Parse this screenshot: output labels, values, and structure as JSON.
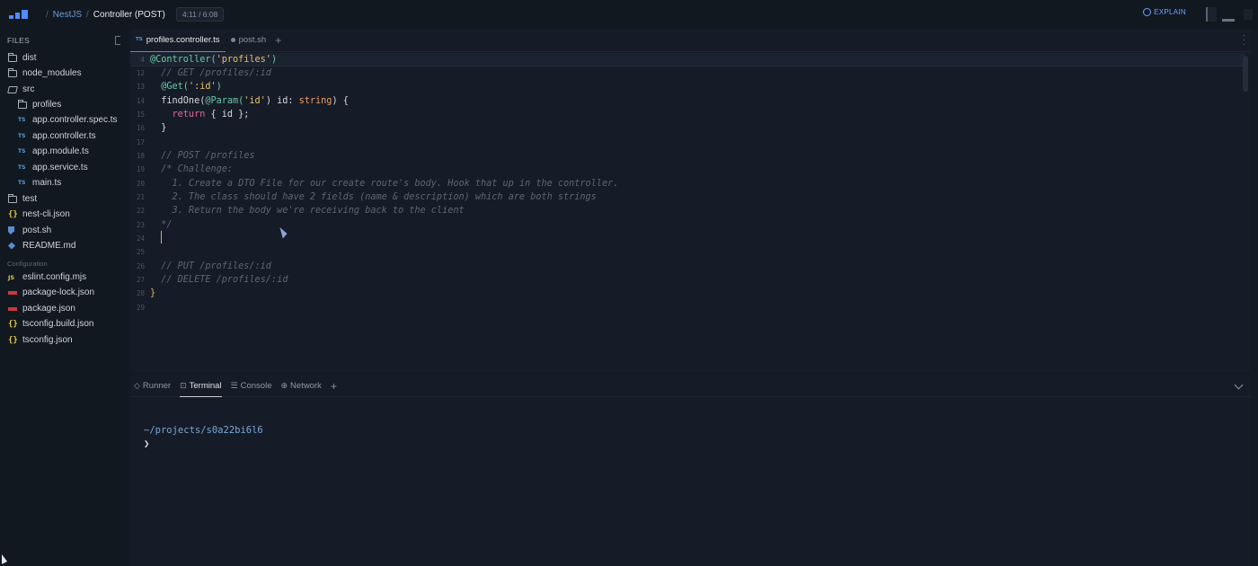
{
  "topbar": {
    "breadcrumb_parent": "NestJS",
    "breadcrumb_current": "Controller (POST)",
    "progress": "4:11 / 6:08",
    "explain_label": "EXPLAIN"
  },
  "sidebar": {
    "title": "FILES",
    "items": [
      {
        "label": "dist",
        "icon": "folder-icon"
      },
      {
        "label": "node_modules",
        "icon": "folder-icon"
      },
      {
        "label": "src",
        "icon": "folder-open-icon"
      },
      {
        "label": "profiles",
        "icon": "folder-icon"
      },
      {
        "label": "app.controller.spec.ts",
        "icon": "ts-icon"
      },
      {
        "label": "app.controller.ts",
        "icon": "ts-icon"
      },
      {
        "label": "app.module.ts",
        "icon": "ts-icon"
      },
      {
        "label": "app.service.ts",
        "icon": "ts-icon"
      },
      {
        "label": "main.ts",
        "icon": "ts-icon"
      },
      {
        "label": "test",
        "icon": "folder-icon"
      },
      {
        "label": "nest-cli.json",
        "icon": "json-icon"
      },
      {
        "label": "post.sh",
        "icon": "shell-icon"
      },
      {
        "label": "README.md",
        "icon": "markdown-icon"
      }
    ],
    "config_section": "Configuration",
    "config_items": [
      {
        "label": "eslint.config.mjs",
        "icon": "js-icon"
      },
      {
        "label": "package-lock.json",
        "icon": "npm-icon"
      },
      {
        "label": "package.json",
        "icon": "npm-icon"
      },
      {
        "label": "tsconfig.build.json",
        "icon": "json-icon"
      },
      {
        "label": "tsconfig.json",
        "icon": "json-icon"
      }
    ]
  },
  "editor": {
    "tabs": [
      {
        "label": "profiles.controller.ts",
        "badge": "TS"
      },
      {
        "label": "post.sh"
      }
    ],
    "lines": {
      "l4": "4",
      "l12": "12",
      "l13": "13",
      "l14": "14",
      "l15": "15",
      "l16": "16",
      "l17": "17",
      "l18": "18",
      "l19": "19",
      "l20": "20",
      "l21": "21",
      "l22": "22",
      "l23": "23",
      "l24": "24",
      "l25": "25",
      "l26": "26",
      "l27": "27",
      "l28": "28",
      "l29": "29"
    },
    "code": {
      "sticky_decorator": "@Controller(",
      "sticky_string": "'profiles'",
      "sticky_close": ")",
      "get_comment": "  // GET /profiles/:id",
      "get_decorator": "  @Get(",
      "get_string": "':id'",
      "get_close": ")",
      "findone_name": "  findOne(",
      "findone_param_dec": "@Param(",
      "findone_param_str": "'id'",
      "findone_param_close": ") id: ",
      "findone_type": "string",
      "findone_close": ") {",
      "return_kw": "    return",
      "return_body": " { id };",
      "close_method": "  }",
      "post_comment": "  // POST /profiles",
      "challenge": "  /* Challenge:",
      "step1": "    1. Create a DTO File for our create route's body. Hook that up in the controller.",
      "step2": "    2. The class should have 2 fields (name & description) which are both strings",
      "step3": "    3. Return the body we're receiving back to the client",
      "comment_end": "  */",
      "put_comment": "  // PUT /profiles/:id",
      "delete_comment": "  // DELETE /profiles/:id",
      "close_class": "}"
    }
  },
  "panel": {
    "tabs": [
      "Runner",
      "Terminal",
      "Console",
      "Network"
    ],
    "terminal_path": "~/projects/s0a22bi6l6",
    "terminal_prompt": "❯"
  }
}
